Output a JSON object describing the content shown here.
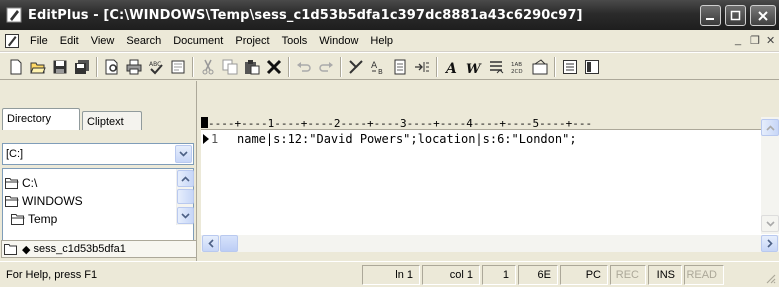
{
  "window": {
    "title": "EditPlus - [C:\\WINDOWS\\Temp\\sess_c1d53b5dfa1c397dc8881a43c6290c97]",
    "buttons": [
      "minimize",
      "restore",
      "close"
    ]
  },
  "menu": {
    "items": [
      "File",
      "Edit",
      "View",
      "Search",
      "Document",
      "Project",
      "Tools",
      "Window",
      "Help"
    ],
    "mdi_controls": [
      "_",
      "̅❐",
      "×"
    ]
  },
  "toolbar": {
    "icons": [
      "new-icon",
      "open-icon",
      "save-icon",
      "save-all-icon",
      "print-preview-icon",
      "print-icon",
      "spell-check-icon",
      "browser-icon",
      "cut-icon",
      "copy-icon",
      "paste-icon",
      "delete-icon",
      "undo-icon",
      "redo-icon",
      "find-icon",
      "replace-icon",
      "file-icon",
      "indent-icon",
      "font-icon",
      "word-wrap-icon",
      "bullets-icon",
      "line-number-icon",
      "preferences-icon",
      "cliptext-icon",
      "dir-icon"
    ]
  },
  "left_pane": {
    "tabs": [
      "Directory",
      "Cliptext"
    ],
    "drive": "[C:]",
    "tree": [
      "C:\\",
      "WINDOWS",
      "Temp"
    ]
  },
  "editor": {
    "ruler": "----+----1----+----2----+----3----+----4----+----5----+---",
    "line_number": "1",
    "code": "name|s:12:\"David Powers\";location|s:6:\"London\";"
  },
  "file_tab": {
    "name": "sess_c1d53b5dfa1"
  },
  "status": {
    "help": "For Help, press F1",
    "ln": "ln 1",
    "col": "col 1",
    "count": "1",
    "hex": "6E",
    "mode": "PC",
    "rec": "REC",
    "ins": "INS",
    "read": "READ"
  },
  "colors": {
    "titlebar": "#2b2b2b",
    "chrome": "#ece9d8",
    "scroll_accent": "#c7d6f7"
  }
}
